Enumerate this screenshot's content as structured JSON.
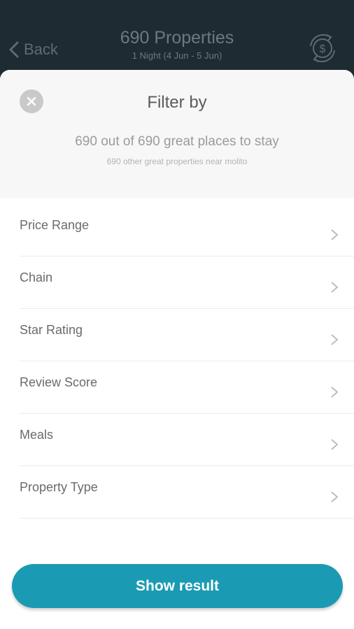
{
  "header": {
    "back_label": "Back",
    "title": "690 Properties",
    "subtitle": "1 Night (4 Jun - 5 Jun)"
  },
  "sheet": {
    "title": "Filter by",
    "summary": "690 out of 690 great places to stay",
    "subsummary": "690 other great properties near molito"
  },
  "filters": [
    {
      "label": "Price Range"
    },
    {
      "label": "Chain"
    },
    {
      "label": "Star Rating"
    },
    {
      "label": "Review Score"
    },
    {
      "label": "Meals"
    },
    {
      "label": "Property Type"
    }
  ],
  "cta": {
    "label": "Show result"
  },
  "colors": {
    "header_bg": "#1f2b33",
    "accent": "#1b9ab3"
  },
  "icons": [
    "chevron-left-icon",
    "currency-exchange-icon",
    "close-icon",
    "chevron-right-icon"
  ]
}
